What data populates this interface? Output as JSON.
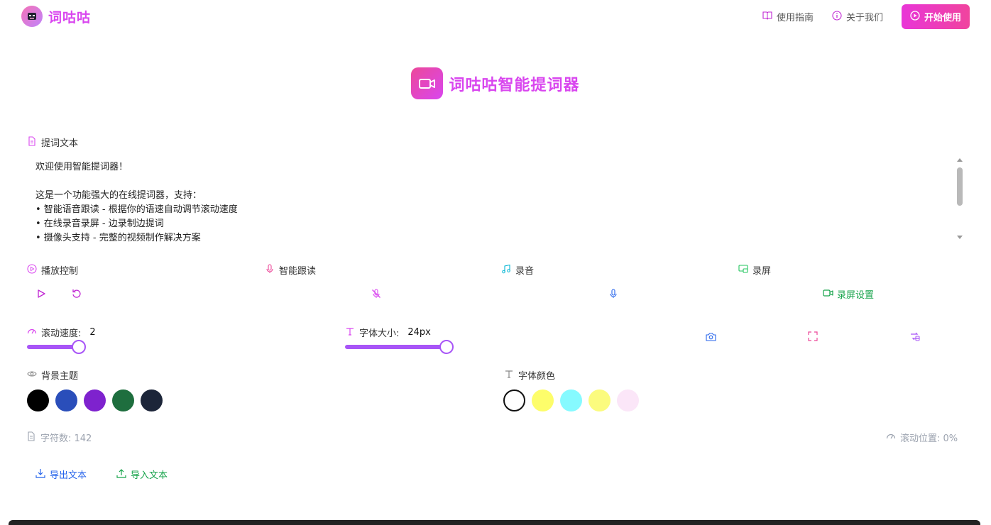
{
  "app": {
    "name": "词咕咕",
    "title": "词咕咕智能提词器"
  },
  "nav": {
    "guide": "使用指南",
    "about": "关于我们",
    "start": "开始使用"
  },
  "editor": {
    "label": "提词文本",
    "lines": [
      "欢迎使用智能提词器！",
      "",
      "这是一个功能强大的在线提词器，支持：",
      "• 智能语音跟读 - 根据你的语速自动调节滚动速度",
      "• 在线录音录屏 - 边录制边提词",
      "• 摄像头支持 - 完整的视频制作解决方案"
    ]
  },
  "sections": {
    "playback": "播放控制",
    "follow": "智能跟读",
    "record": "录音",
    "screen": "录屏",
    "screen_settings": "录屏设置"
  },
  "speed": {
    "label": "滚动速度:",
    "value": "2",
    "fraction": 0.4
  },
  "font_size": {
    "label": "字体大小:",
    "value": "24px",
    "fraction": 1.0
  },
  "background": {
    "label": "背景主题",
    "colors": [
      "#000000",
      "#2a4eba",
      "#7e22ce",
      "#1e6e3e",
      "#1c2539"
    ]
  },
  "font_color": {
    "label": "字体颜色",
    "colors": [
      "#ffffff",
      "#fdfd6a",
      "#86faff",
      "#fbfb7e",
      "#fbe6f8"
    ]
  },
  "stats": {
    "chars": "字符数: 142",
    "scroll_pos": "滚动位置: 0%"
  },
  "actions": {
    "export": "导出文本",
    "import": "导入文本"
  },
  "accent": "#d946ef"
}
